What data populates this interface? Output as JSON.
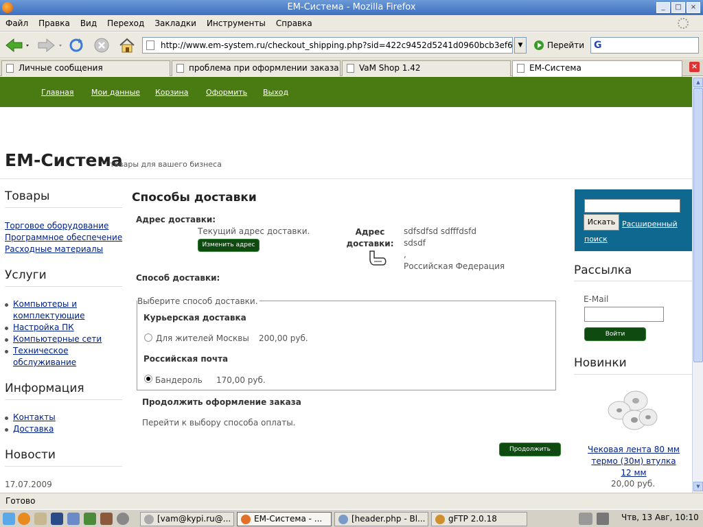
{
  "window": {
    "title": "ЕМ-Система - Mozilla Firefox"
  },
  "menu": [
    "Файл",
    "Правка",
    "Вид",
    "Переход",
    "Закладки",
    "Инструменты",
    "Справка"
  ],
  "toolbar": {
    "url": "http://www.em-system.ru/checkout_shipping.php?sid=422c9452d5241d0960bcb3ef6590",
    "go_label": "Перейти",
    "search_value": ""
  },
  "tabs": [
    "Личные сообщения",
    "проблема при оформлении заказа",
    "VaM Shop 1.42",
    "ЕМ-Система"
  ],
  "site": {
    "nav": [
      "Главная",
      "Мои данные",
      "Корзина",
      "Оформить",
      "Выход"
    ],
    "logo": "ЕМ-Система",
    "slogan": "товары для вашего бизнеса"
  },
  "left": {
    "goods_title": "Товары",
    "goods": [
      "Торговое оборудование",
      "Программное обеспечение",
      "Расходные материалы"
    ],
    "services_title": "Услуги",
    "services": [
      "Компьютеры и комплектующие",
      "Настройка ПК",
      "Компьютерные сети",
      "Техническое обслуживание"
    ],
    "info_title": "Информация",
    "info": [
      "Контакты",
      "Доставка"
    ],
    "news_title": "Новости",
    "news_date": "17.07.2009"
  },
  "main": {
    "title": "Способы доставки",
    "address_heading": "Адрес доставки:",
    "current_address": "Текущий адрес доставки.",
    "change_address": "Изменить адрес",
    "address_label": "Адрес доставки:",
    "address_lines": [
      "sdfsdfsd sdfffdsfd",
      "sdsdf",
      ",",
      "Российская Федерация"
    ],
    "method_heading": "Способ доставки:",
    "choose_legend": "Выберите способ доставки.",
    "courier_title": "Курьерская доставка",
    "courier_option": "Для жителей Москвы",
    "courier_price": "200,00 руб.",
    "post_title": "Российская почта",
    "post_option": "Бандероль",
    "post_price": "170,00 руб.",
    "continue_heading": "Продолжить оформление заказа",
    "continue_text": "Перейти к выбору способа оплаты.",
    "continue_button": "Продолжить"
  },
  "right": {
    "search_button": "Искать",
    "advanced_search": "Расширенный поиск",
    "newsletter_title": "Рассылка",
    "email_label": "E-Mail",
    "login_button": "Войти",
    "new_title": "Новинки",
    "product_name": "Чековая лента 80 мм термо (30м) втулка 12 мм",
    "product_price": "20,00 руб."
  },
  "status": {
    "text": "Готово"
  },
  "taskbar": {
    "buttons": [
      "[vam@kypi.ru@...",
      "ЕМ-Система - ...",
      "[header.php - Bl...",
      "gFTP 2.0.18"
    ],
    "clock": "Чтв, 13 Авг, 10:10"
  }
}
